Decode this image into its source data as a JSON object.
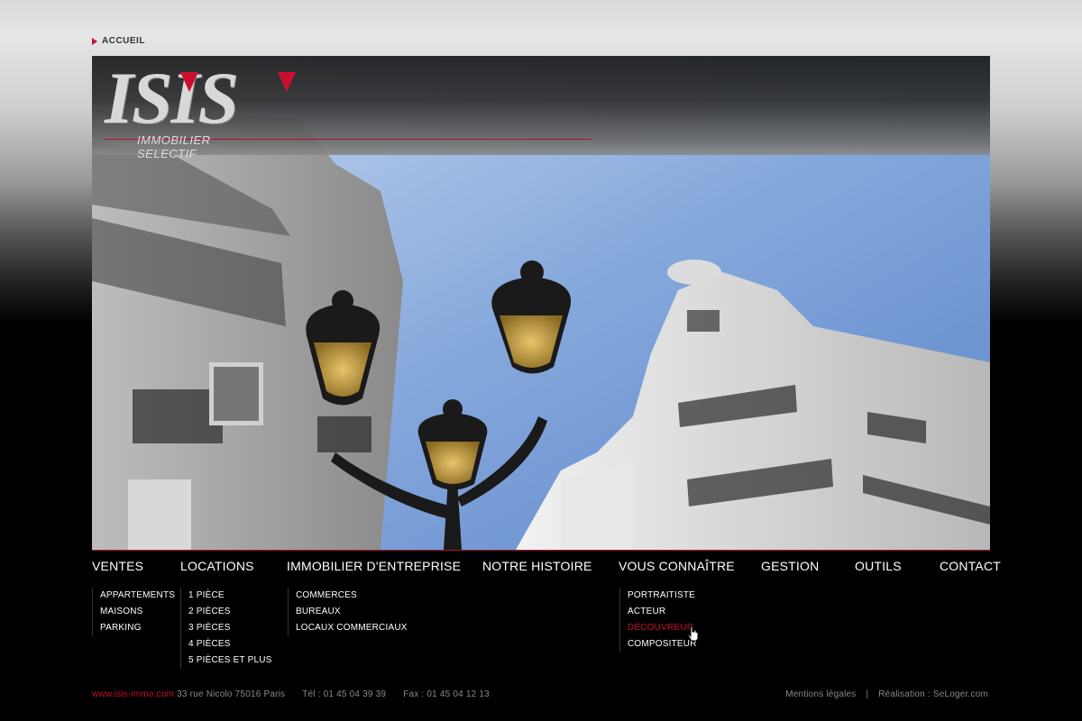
{
  "breadcrumb": {
    "label": "ACCUEIL"
  },
  "logo": {
    "letters": "ISIS",
    "subtitle": "IMMOBILIER SELECTIF"
  },
  "nav": [
    {
      "label": "VENTES"
    },
    {
      "label": "LOCATIONS"
    },
    {
      "label": "IMMOBILIER D'ENTREPRISE"
    },
    {
      "label": "NOTRE HISTOIRE"
    },
    {
      "label": "VOUS CONNAÎTRE"
    },
    {
      "label": "GESTION"
    },
    {
      "label": "OUTILS"
    },
    {
      "label": "CONTACT"
    }
  ],
  "submenus": {
    "ventes": [
      "APPARTEMENTS",
      "MAISONS",
      "PARKING"
    ],
    "locations": [
      "1 PIÈCE",
      "2 PIÈCES",
      "3 PIÈCES",
      "4 PIÈCES",
      "5 PIÈCES ET PLUS"
    ],
    "entreprise": [
      "COMMERCES",
      "BUREAUX",
      "LOCAUX COMMERCIAUX"
    ],
    "connaitre": [
      "PORTRAITISTE",
      "ACTEUR",
      "DÉCOUVREUR",
      "COMPOSITEUR"
    ]
  },
  "footer": {
    "site": "www.isis-immo.com",
    "address": "33 rue Nicolo 75016 Paris",
    "tel": "Tél : 01 45 04 39 39",
    "fax": "Fax : 01 45 04 12 13",
    "legal": "Mentions légales",
    "separator": "|",
    "credit": "Réalisation : SeLoger.com"
  },
  "colors": {
    "accent": "#c8102e",
    "sky": "#7ea4d9",
    "text": "#ffffff"
  }
}
